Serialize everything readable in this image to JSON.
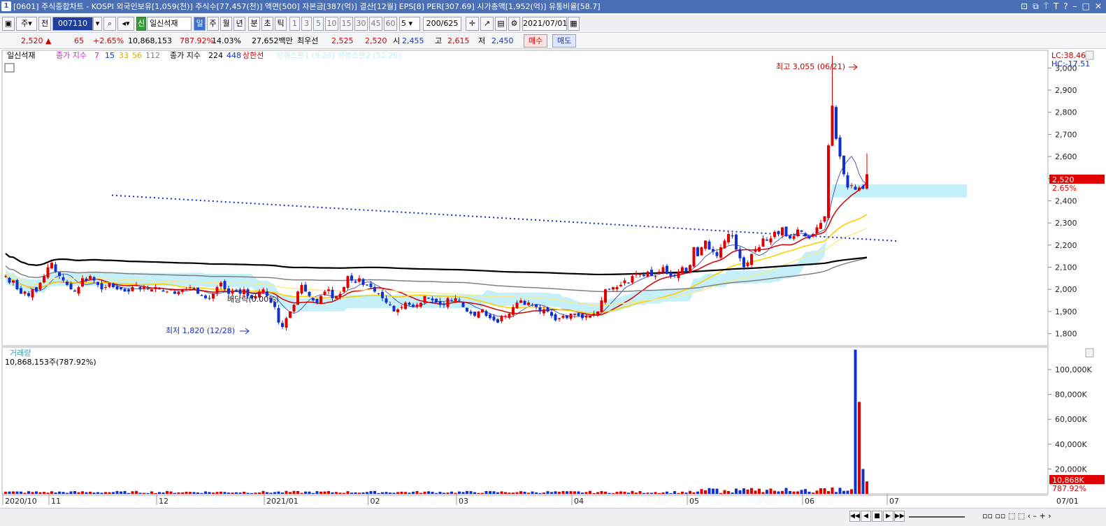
{
  "title_bar": {
    "num": "1",
    "text": "[0601] 주식종합차트 - KOSPI 외국인보유[1,059(천)] 주식수[77,457(천)] 액면[500] 자본금[387(억)] 결산[12월] EPS[8] PER[307.69] 시가총액[1,952(억)] 유통비율[58.7]",
    "controls": [
      "⊡",
      "⧉",
      "⍑",
      "T",
      "?",
      "–",
      "□",
      "✕"
    ]
  },
  "toolbar": {
    "market_label": "주",
    "code_prefix": "전",
    "stock_code": "007110",
    "stock_flag": "신",
    "stock_name": "일신석재",
    "periods": [
      "일",
      "주",
      "월",
      "년",
      "분",
      "초",
      "틱"
    ],
    "minute_options": [
      "1",
      "3",
      "5",
      "10",
      "15",
      "30",
      "45",
      "60"
    ],
    "interval_value": "5",
    "count_display": "200/625",
    "date": "2021/07/01"
  },
  "quote_bar": {
    "price": "2,520",
    "arrow": "▲",
    "change": "65",
    "change_pct": "+2.65%",
    "volume": "10,868,153",
    "volume_pct": "787.92%",
    "turnover": "14.03%",
    "amount": "27,652백만",
    "best_label": "최우선",
    "ask": "2,525",
    "bid": "2,520",
    "open_label": "시",
    "open": "2,455",
    "high_label": "고",
    "high": "2,615",
    "low_label": "저",
    "low": "2,450",
    "buy_label": "매수",
    "sell_label": "매도"
  },
  "legend": {
    "stock": "일신석재",
    "ma_short_label": "종가 지수",
    "ma_short_periods": [
      "7",
      "15",
      "33",
      "56",
      "112"
    ],
    "ma_long_label": "종가 지수",
    "ma_long_periods": [
      "224",
      "448"
    ],
    "upper_limit": "상한선",
    "cloud_legend": "선행스팬1 (9,26) 선행스팬2 (52,26)"
  },
  "colors": {
    "up": "#e00000",
    "down": "#1030d0",
    "cloud": "#bfeefa",
    "ma7": "#283aa8",
    "ma15": "#d40000",
    "ma33": "#ffd000",
    "ma56": "#f6e98a",
    "ma112": "#808080",
    "ma224": "#000000"
  },
  "price_chart": {
    "annotations": {
      "max": "최고 3,055 (06/21)",
      "min": "최저 1,820 (12/28)",
      "ex_div": "배당락(0.00%)"
    },
    "lc": "LC:38.46",
    "hc": "HC:-17.51",
    "price_tag": "2,520",
    "pct_tag": "2.65%"
  },
  "volume_chart": {
    "title": "거래량",
    "info": "10,868,153주(787.92%)",
    "current_tag": "10,868K",
    "pct_tag": "787.92%"
  },
  "chart_data": [
    {
      "type": "candlestick",
      "title": "일신석재",
      "y_axis_labels": [
        "3,000",
        "2,900",
        "2,800",
        "2,700",
        "2,600",
        "2,500",
        "2,400",
        "2,300",
        "2,200",
        "2,100",
        "2,000",
        "1,900",
        "1,800"
      ],
      "x_axis_labels": [
        "2020/10",
        "11",
        "12",
        "2021/01",
        "02",
        "03",
        "04",
        "05",
        "06",
        "07",
        "07/01"
      ],
      "ylim": [
        1745,
        3080
      ],
      "max_price": 3055,
      "min_price": 1820,
      "last": {
        "open": 2455,
        "high": 2615,
        "low": 2450,
        "close": 2520
      },
      "closes": [
        2060,
        2030,
        2040,
        2000,
        1980,
        1990,
        1970,
        2000,
        1990,
        2030,
        2060,
        2100,
        2120,
        2080,
        2060,
        2040,
        2020,
        2000,
        1990,
        2010,
        2050,
        2040,
        2060,
        2040,
        2020,
        2000,
        2010,
        2030,
        2010,
        2000,
        2000,
        1990,
        1990,
        2010,
        2020,
        2000,
        2010,
        2000,
        2000,
        2010,
        2000,
        1990,
        1990,
        2000,
        1980,
        1990,
        2000,
        2000,
        2010,
        2000,
        1980,
        1970,
        1960,
        1960,
        1980,
        2010,
        2030,
        2000,
        1980,
        1990,
        1990,
        1980,
        2000,
        1970,
        1960,
        1970,
        1990,
        2000,
        1970,
        1940,
        1920,
        1850,
        1830,
        1870,
        1900,
        1930,
        1990,
        2020,
        1990,
        1970,
        1950,
        1940,
        1970,
        1990,
        2000,
        1960,
        1970,
        1980,
        2010,
        2060,
        2040,
        2030,
        2050,
        2020,
        2020,
        2010,
        1990,
        1980,
        1960,
        1940,
        1930,
        1900,
        1910,
        1920,
        1940,
        1930,
        1920,
        1930,
        1940,
        1970,
        1960,
        1950,
        1940,
        1930,
        1930,
        1960,
        1950,
        1960,
        1950,
        1920,
        1900,
        1890,
        1880,
        1900,
        1910,
        1880,
        1870,
        1860,
        1850,
        1880,
        1880,
        1890,
        1920,
        1940,
        1950,
        1930,
        1940,
        1930,
        1920,
        1900,
        1910,
        1900,
        1880,
        1860,
        1870,
        1880,
        1870,
        1890,
        1890,
        1880,
        1870,
        1880,
        1880,
        1890,
        1900,
        1950,
        2000,
        2000,
        2010,
        2010,
        2020,
        2040,
        2030,
        2060,
        2070,
        2070,
        2060,
        2080,
        2060,
        2060,
        2080,
        2100,
        2070,
        2060,
        2060,
        2080,
        2100,
        2080,
        2110,
        2190,
        2150,
        2190,
        2220,
        2180,
        2170,
        2150,
        2190,
        2220,
        2250,
        2240,
        2180,
        2140,
        2100,
        2120,
        2160,
        2180,
        2190,
        2230,
        2220,
        2230,
        2260,
        2250,
        2280,
        2240,
        2230,
        2240,
        2270,
        2260,
        2240,
        2230,
        2250,
        2280,
        2300,
        2330,
        2650,
        2830,
        2680,
        2600,
        2520,
        2460,
        2470,
        2450,
        2460,
        2455,
        2520
      ]
    },
    {
      "type": "bar",
      "title": "거래량",
      "y_axis_labels": [
        "100,000K",
        "80,000K",
        "60,000K",
        "40,000K",
        "20,000K"
      ],
      "ylim": [
        0,
        118000
      ],
      "series": [
        {
          "name": "거래량",
          "note": "thousand shares",
          "spikes": [
            {
              "index": 221,
              "value": 116000
            },
            {
              "index": 222,
              "value": 74000
            },
            {
              "index": 223,
              "value": 20000
            },
            {
              "index": 224,
              "value": 10000
            },
            {
              "index": 225,
              "value": 8000
            },
            {
              "index": 227,
              "value": 5000
            },
            {
              "index": 230,
              "value": 10868
            }
          ]
        }
      ]
    }
  ]
}
